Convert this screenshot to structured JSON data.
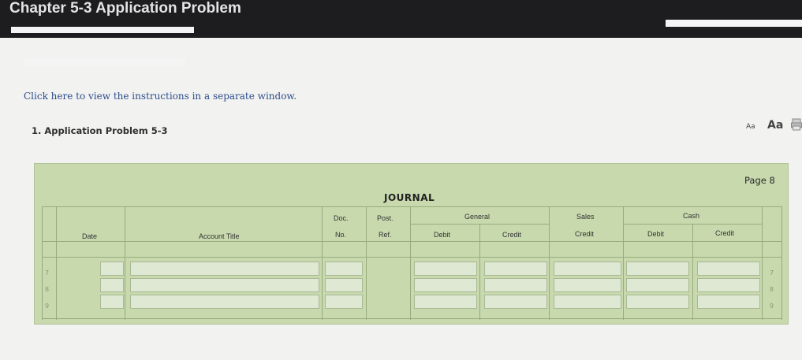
{
  "header": {
    "title": "Chapter 5-3 Application Problem"
  },
  "instructions_link": "Click here to view the instructions in a separate window.",
  "problem_label": "1. Application Problem 5-3",
  "font_controls": {
    "small": "Aa",
    "large": "Aa"
  },
  "journal": {
    "title": "JOURNAL",
    "page": "Page 8",
    "columns": {
      "date": "Date",
      "account_title": "Account Title",
      "doc_top": "Doc.",
      "doc_bottom": "No.",
      "post_top": "Post.",
      "post_bottom": "Ref.",
      "general": "General",
      "general_debit": "Debit",
      "general_credit": "Credit",
      "sales_top": "Sales",
      "sales_bottom": "Credit",
      "cash": "Cash",
      "cash_debit": "Debit",
      "cash_credit": "Credit"
    },
    "row_numbers": [
      "7",
      "8",
      "9"
    ]
  }
}
